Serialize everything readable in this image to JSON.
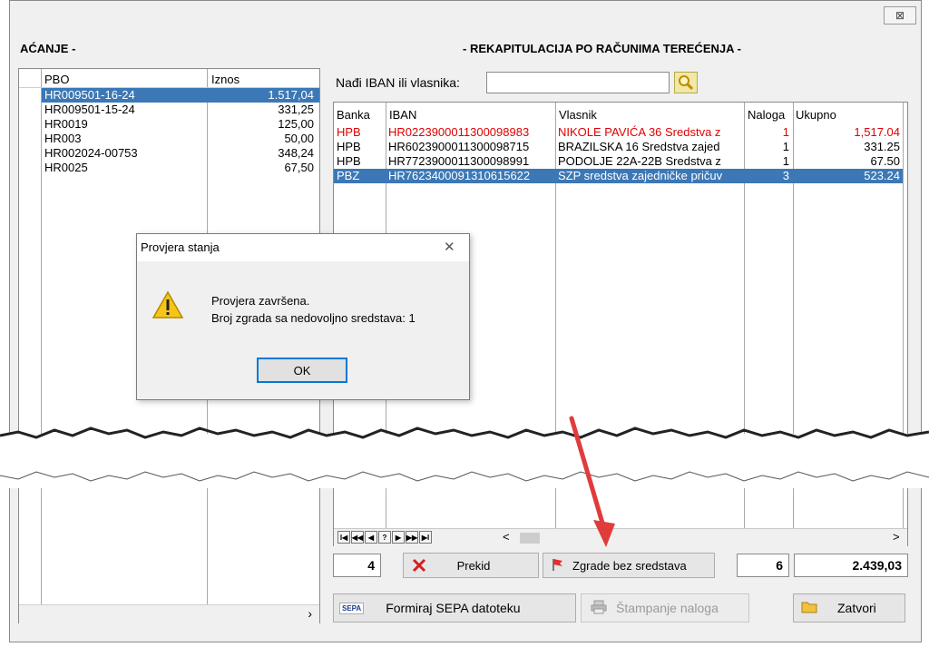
{
  "window": {
    "close_label": "⊠"
  },
  "left_panel": {
    "title": "AĆANJE -",
    "columns": [
      "PBO",
      "Iznos"
    ],
    "rows": [
      {
        "pbo": "HR009501-16-24",
        "iznos": "1.517,04",
        "selected": true
      },
      {
        "pbo": "HR009501-15-24",
        "iznos": "331,25"
      },
      {
        "pbo": "HR0019",
        "iznos": "125,00"
      },
      {
        "pbo": "HR003",
        "iznos": "50,00"
      },
      {
        "pbo": "HR002024-00753",
        "iznos": "348,24"
      },
      {
        "pbo": "HR0025",
        "iznos": "67,50"
      }
    ],
    "scroll_right": "›"
  },
  "right_panel": {
    "title": "- REKAPITULACIJA PO RAČUNIMA TEREĆENJA -",
    "search": {
      "label": "Nađi IBAN ili vlasnika:",
      "value": "",
      "icon": "search-icon"
    },
    "columns": [
      "Banka",
      "IBAN",
      "Vlasnik",
      "Naloga",
      "Ukupno"
    ],
    "rows": [
      {
        "banka": "HPB",
        "iban": "HR0223900011300098983",
        "vlasnik": "NIKOLE PAVIĆA 36  Sredstva z",
        "naloga": "1",
        "ukupno": "1,517.04",
        "red": true
      },
      {
        "banka": "HPB",
        "iban": "HR6023900011300098715",
        "vlasnik": "BRAZILSKA 16  Sredstva zajed",
        "naloga": "1",
        "ukupno": "331.25"
      },
      {
        "banka": "HPB",
        "iban": "HR7723900011300098991",
        "vlasnik": "PODOLJE 22A-22B  Sredstva z",
        "naloga": "1",
        "ukupno": "67.50"
      },
      {
        "banka": "PBZ",
        "iban": "HR7623400091310615622",
        "vlasnik": "SZP sredstva zajedničke pričuv",
        "naloga": "3",
        "ukupno": "523.24",
        "selected": true
      }
    ],
    "nav_buttons": [
      "I◀",
      "◀◀",
      "◀",
      "?",
      "▶",
      "▶▶",
      "▶I"
    ],
    "scroll_left": "<",
    "scroll_right": ">"
  },
  "footer": {
    "count_left": "4",
    "prekid_label": "Prekid",
    "zgrade_label": "Zgrade bez sredstava",
    "count_right": "6",
    "total": "2.439,03",
    "sepa_label": "Formiraj SEPA datoteku",
    "sepa_icon_text": "SEPA",
    "stampanje_label": "Štampanje naloga",
    "zatvori_label": "Zatvori"
  },
  "dialog": {
    "title": "Provjera stanja",
    "message_line1": "Provjera završena.",
    "message_line2": "Broj zgrada sa nedovoljno sredstava: 1",
    "ok_label": "OK",
    "close_label": "✕"
  },
  "colors": {
    "selection": "#3c78b5",
    "alert_red": "#e00000",
    "arrow": "#e03c3c"
  }
}
